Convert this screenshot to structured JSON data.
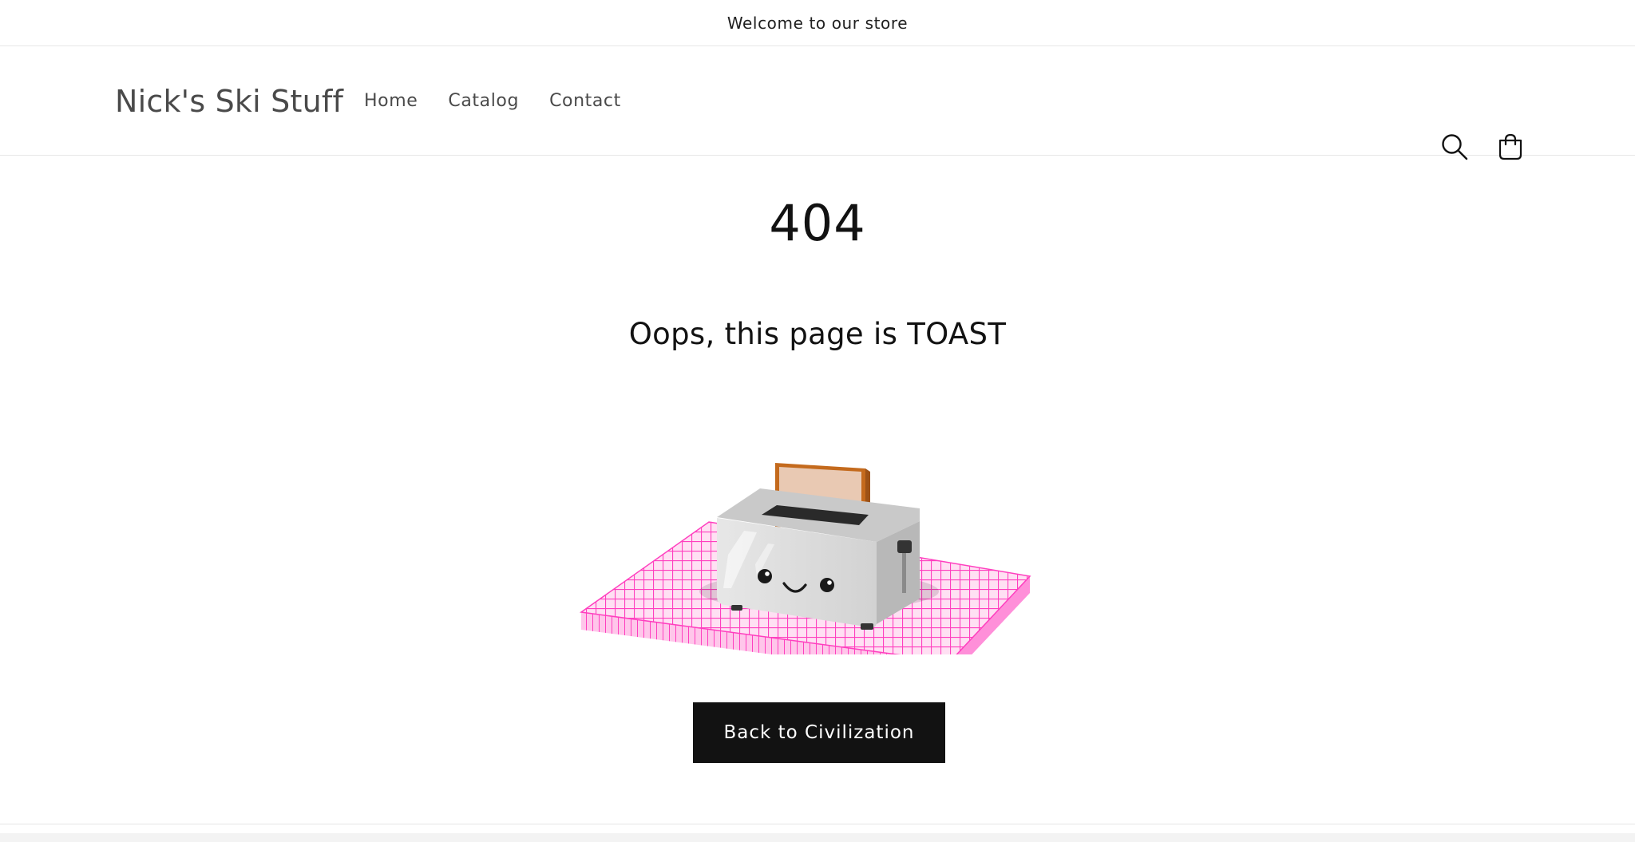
{
  "announcement": {
    "text": "Welcome to our store"
  },
  "header": {
    "logo": "Nick's Ski Stuff",
    "nav": [
      {
        "label": "Home"
      },
      {
        "label": "Catalog"
      },
      {
        "label": "Contact"
      }
    ],
    "icons": {
      "search": "search-icon",
      "cart": "cart-icon"
    }
  },
  "main": {
    "error_code": "404",
    "message": "Oops, this page is TOAST",
    "button_label": "Back to Civilization",
    "illustration": "toaster-on-pink-grid-mat"
  },
  "colors": {
    "text": "#121212",
    "muted": "#4a4a4a",
    "button_bg": "#121212",
    "button_text": "#ffffff",
    "mat": "#ff4fc8",
    "toast": "#e9c9b3",
    "toast_crust": "#c46a1d"
  }
}
